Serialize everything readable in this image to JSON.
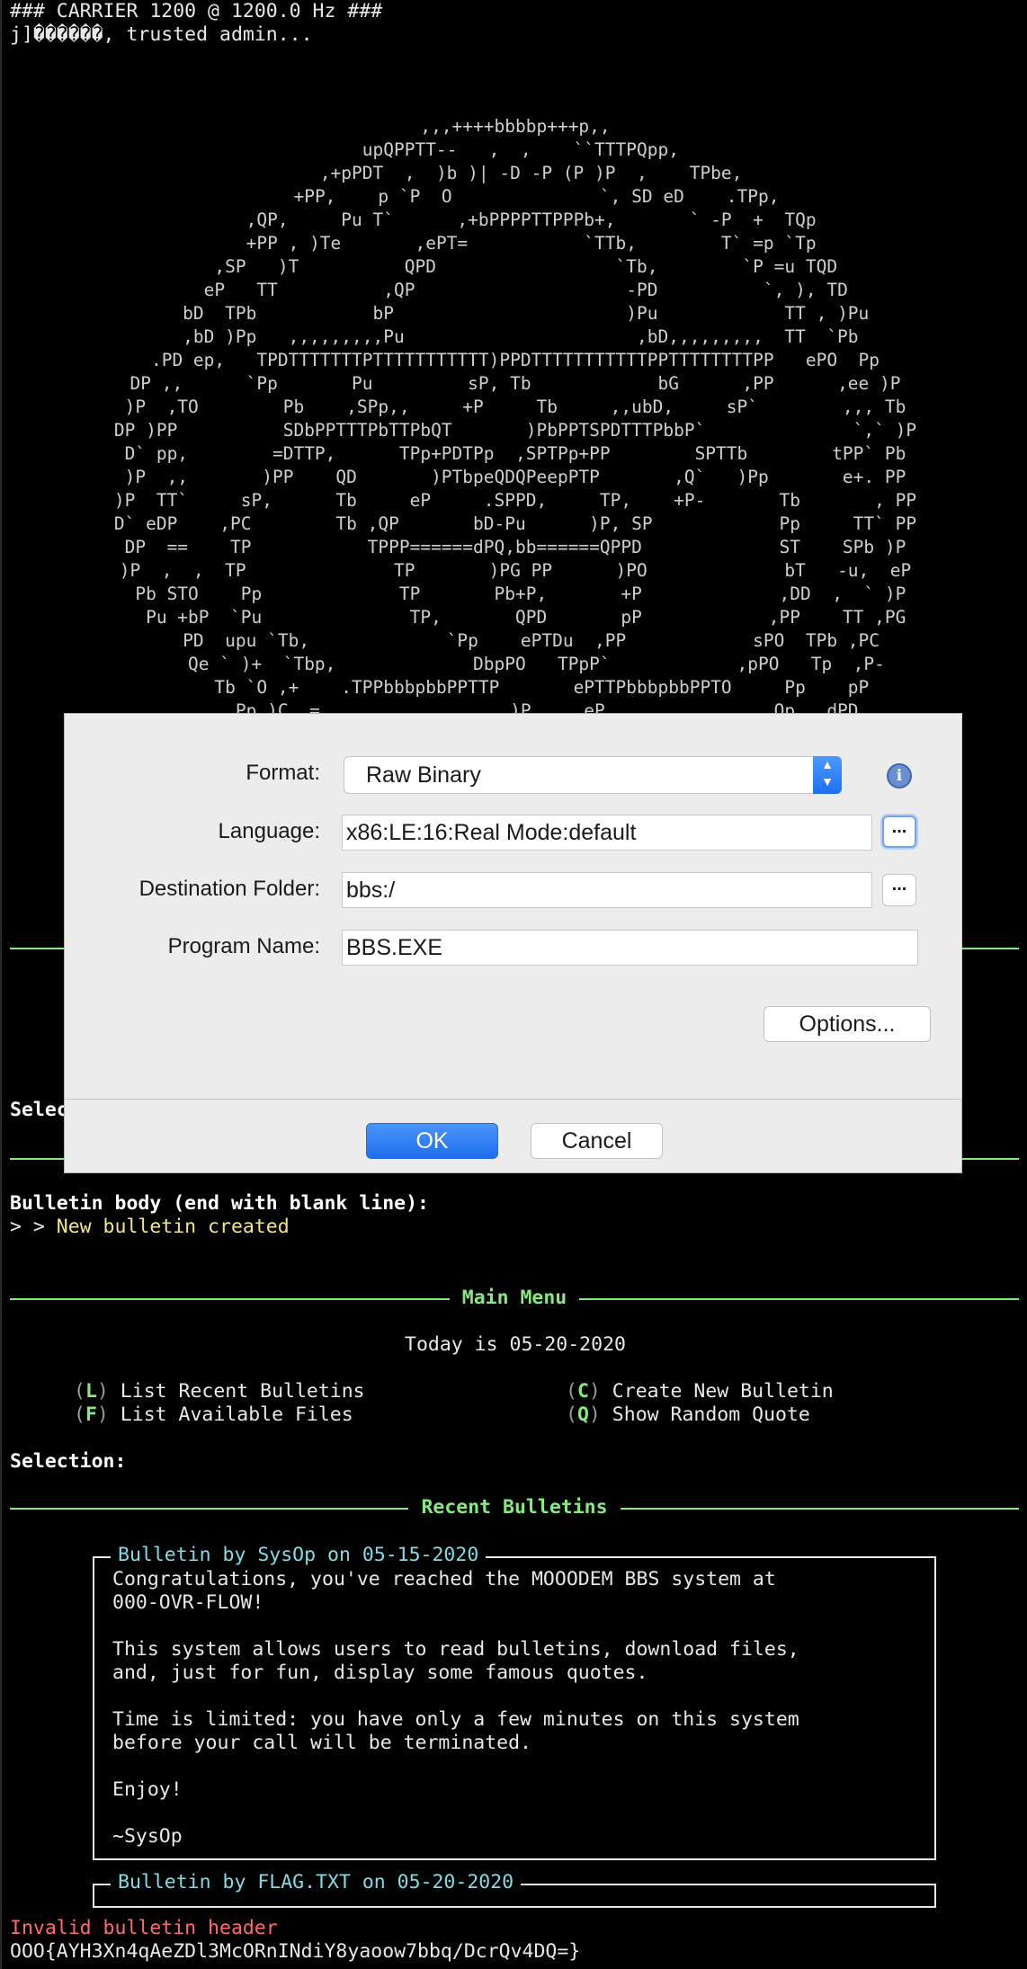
{
  "terminal": {
    "header_line1": "### CARRIER 1200 @ 1200.0 Hz ###",
    "header_line2": "j]������, trusted admin...",
    "ascii_art": ",,,++++bbbbp+++p,,\n upQPPTT--   ,  ,    ``TTTPQpp,\n   ,+pPDT  ,  )b )| -D -P (P )P  ,    TPbe,\n    +PP,    p `P  O              `, SD eD    .TPp,\n   ,QP,     Pu T`      ,+bPPPPTTPPPb+,       ` -P  +  TQp\n   +PP , )Te       ,ePT=           `TTb,        T` =p `Tp\n  ,SP   )T          QPD                 `Tb,        `P =u TQD\n  eP   TT          ,QP                    -PD          `, ), TD\n  bD  TPb           bP                      )Pu            TT , )Pu\n ,bD )Pp   ,,,,,,,,,Pu                      ,bD,,,,,,,,,  TT  `Pb\n.PD ep,   TPDTTTTTTTPTTTTTTTTTTT)PPDTTTTTTTTTTTPPTTTTTTTTPP   ePO  Pp\nDP ,,      `Pp       Pu         sP, Tb            bG      ,PP      ,ee )P\n)P  ,TO        Pb    ,SPp,,     +P     Tb     ,,ubD,     sP`        ,,, Tb\nDP )PP          SDbPPTTTPbTTPbQT       )PbPPTSPDTTTPbbP`              `,` )P\nD` pp,        =DTTP,      TPp+PDTPp  ,SPTPp+PP        SPTTb        tPP` Pb\n)P  ,,       )PP    QD       )PTbpeQDQPeepPTP       ,Q`   )Pp       e+. PP\n)P  TT`     sP,      Tb     eP     .SPPD,     TP,    +P-       Tb       , PP\nD` eDP    ,PC        Tb ,QP       bD-Pu      )P, SP            Pp     TT` PP\nDP  ==    TP           TPPP======dPQ,bb======QPPD             ST    SPb )P\n)P  ,  ,  TP              TP       )PG PP      )PO             bT   -u,  eP\n Pb STO    Pp             TP       Pb+P,       +P             ,DD  ,  ` )P\n  Pu +bP  `Pu              TP,       QPD       pP            ,PP    TT ,PG\n   PD  upu `Tb,             `Pp    ePTDu  ,PP            sPO  TPb ,PC\n    Qe ` )+  `Tbp,             DbpPO   TPpP`            ,pPO   Tp  ,P-\n     Tb `O ,+    .TPPbbbpbbPPTTP       ePTTPbbbpbbPPTO     Pp    pP\n      Pp )C  =                  )P     eP                Op   dPD",
    "select_partial": "Selec",
    "bulletin_prompt": "Bulletin body (end with blank line):",
    "bulletin_created_prefix": "> > ",
    "bulletin_created": "New bulletin created",
    "main_menu_title": "Main Menu",
    "today": "Today is 05-20-2020",
    "menu": [
      {
        "key": "L",
        "label": " List Recent Bulletins"
      },
      {
        "key": "C",
        "label": " Create New Bulletin"
      },
      {
        "key": "F",
        "label": " List Available Files"
      },
      {
        "key": "Q",
        "label": " Show Random Quote"
      }
    ],
    "selection_prompt": "Selection:",
    "recent_bulletins_title": "Recent Bulletins",
    "bulletin1_header": "Bulletin by SysOp on 05-15-2020",
    "bulletin1_body": "Congratulations, you've reached the MOOODEM BBS system at\n000-OVR-FLOW!\n\nThis system allows users to read bulletins, download files,\nand, just for fun, display some famous quotes.\n\nTime is limited: you have only a few minutes on this system\nbefore your call will be terminated.\n\nEnjoy!\n\n~SysOp",
    "bulletin2_header": "Bulletin by FLAG.TXT on 05-20-2020",
    "error": "Invalid bulletin header",
    "flag": "OOO{AYH3Xn4qAeZDl3McORnINdiY8yaoow7bbq/DcrQv4DQ=}"
  },
  "dialog": {
    "format_label": "Format:",
    "format_value": "Raw Binary",
    "language_label": "Language:",
    "language_value": "x86:LE:16:Real Mode:default",
    "destination_label": "Destination Folder:",
    "destination_value": "bbs:/",
    "program_label": "Program Name:",
    "program_value": "BBS.EXE",
    "browse_label": "...",
    "options_label": "Options...",
    "ok_label": "OK",
    "cancel_label": "Cancel",
    "info_glyph": "i",
    "stepper_up": "▲",
    "stepper_down": "▼"
  },
  "colors": {
    "terminal_bg": "#000000",
    "menu_green": "#87e87f",
    "bulletin_cyan": "#7fdde6",
    "success_yellow": "#f2e58c",
    "error_red": "#ff6b6b",
    "primary_blue": "#1f6ef0"
  }
}
